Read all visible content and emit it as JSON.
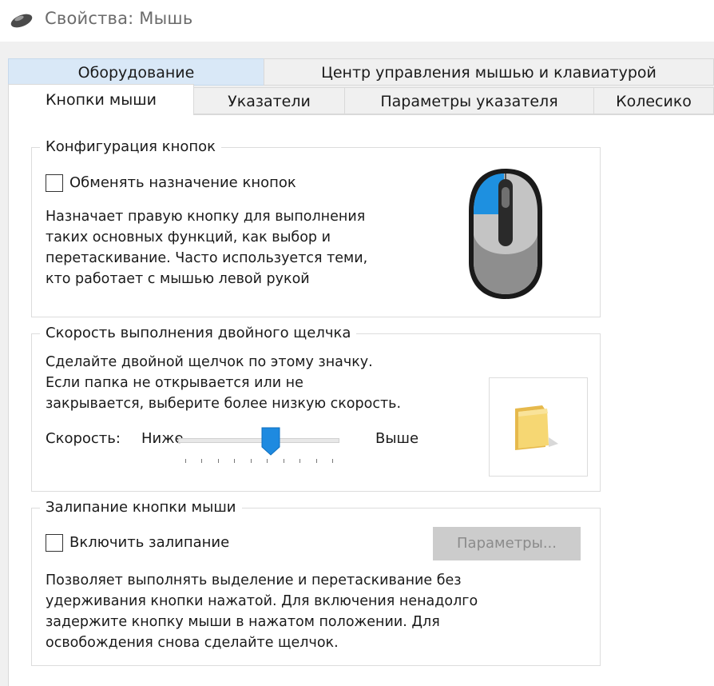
{
  "window": {
    "title": "Свойства: Мышь",
    "icon": "mouse-icon"
  },
  "tabs": {
    "row1": [
      {
        "label": "Оборудование",
        "state": "hover"
      },
      {
        "label": "Центр управления мышью и клавиатурой",
        "state": "normal"
      }
    ],
    "row2": [
      {
        "label": "Кнопки мыши",
        "state": "active"
      },
      {
        "label": "Указатели",
        "state": "normal"
      },
      {
        "label": "Параметры указателя",
        "state": "normal"
      },
      {
        "label": "Колесико",
        "state": "normal"
      }
    ]
  },
  "button_config": {
    "legend": "Конфигурация кнопок",
    "checkbox_label": "Обменять назначение кнопок",
    "checked": false,
    "description": "Назначает правую кнопку для выполнения\nтаких основных функций, как выбор и\nперетаскивание. Часто используется теми,\nкто работает с мышью левой рукой",
    "image": "mouse-left-button-highlighted-icon"
  },
  "double_click": {
    "legend": "Скорость выполнения двойного щелчка",
    "description": "Сделайте двойной щелчок по этому значку.\nЕсли папка не открывается или не\nзакрывается, выберите более низкую скорость.",
    "speed_label": "Скорость:",
    "low_label": "Ниже",
    "high_label": "Выше",
    "speed_fraction": 0.58,
    "test_icon": "folder-icon"
  },
  "click_lock": {
    "legend": "Залипание кнопки мыши",
    "checkbox_label": "Включить залипание",
    "checked": false,
    "settings_button": "Параметры...",
    "settings_enabled": false,
    "description": "Позволяет выполнять выделение и перетаскивание без\nудерживания кнопки нажатой. Для включения ненадолго\nзадержите кнопку мыши в нажатом положении. Для\nосвобождения снова сделайте щелчок."
  },
  "colors": {
    "accent_blue": "#1e90e0",
    "hover_tab": "#d9e8f7",
    "dialog_bg": "#f0f0f0"
  }
}
